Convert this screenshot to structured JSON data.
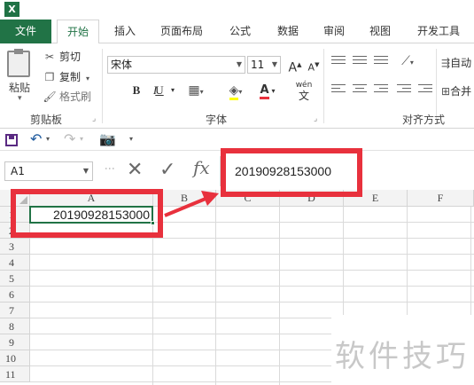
{
  "app": {
    "logo_letter": "X",
    "accent": "#217346"
  },
  "tabs": {
    "file": "文件",
    "home": "开始",
    "insert": "插入",
    "page_layout": "页面布局",
    "formulas": "公式",
    "data": "数据",
    "review": "审阅",
    "view": "视图",
    "developer": "开发工具"
  },
  "ribbon": {
    "clipboard": {
      "paste": "粘贴",
      "cut": "剪切",
      "copy": "复制",
      "format_painter": "格式刷",
      "group_label": "剪贴板"
    },
    "font": {
      "name": "宋体",
      "size": "11",
      "bold": "B",
      "italic": "I",
      "underline": "U",
      "font_color_glyph": "A",
      "phonetic": "wén",
      "grow": "A",
      "shrink": "A",
      "group_label": "字体"
    },
    "alignment": {
      "wrap_text_label": "自动",
      "merge_label": "合并",
      "group_label": "对齐方式"
    }
  },
  "qat": {
    "icons": [
      "save-icon",
      "undo-icon",
      "redo-icon",
      "camera-icon",
      "customize-icon"
    ]
  },
  "formula_bar": {
    "name_box": "A1",
    "cancel_glyph": "✕",
    "enter_glyph": "✓",
    "fx_glyph": "fx",
    "content": "20190928153000"
  },
  "grid": {
    "columns": [
      "A",
      "B",
      "C",
      "D",
      "E",
      "F"
    ],
    "rows": [
      "1",
      "2",
      "3",
      "4",
      "5",
      "6",
      "7",
      "8",
      "9",
      "10",
      "11"
    ],
    "cells": {
      "A1": "20190928153000"
    },
    "selected_cell": "A1"
  },
  "annotation": {
    "color": "#e8313d"
  },
  "watermark": "软件技巧"
}
